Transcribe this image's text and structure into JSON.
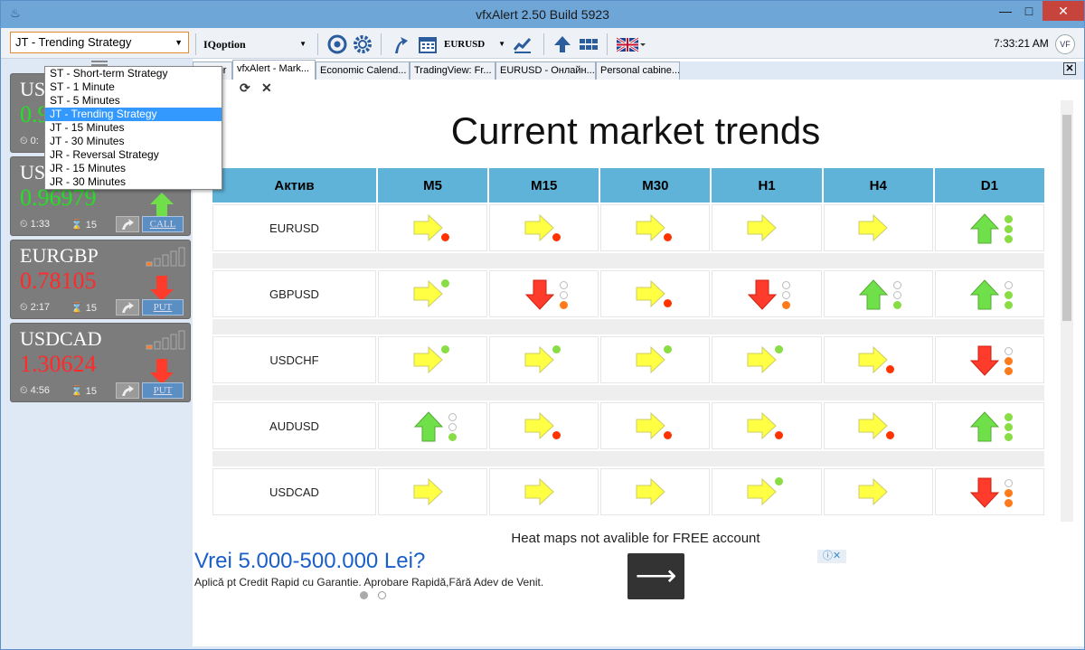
{
  "window": {
    "title": "vfxAlert 2.50 Build 5923",
    "minimize": "—",
    "maximize": "□",
    "close": "✕"
  },
  "toolbar": {
    "strategy_value": "JT - Trending Strategy",
    "broker_value": "IQoption",
    "pair_value": "EURUSD",
    "clock": "7:33:21 AM",
    "icons": [
      "chrome-icon",
      "settings-icon",
      "trend-arrow-icon",
      "calendar-icon",
      "chart-line-icon",
      "up-arrow-icon",
      "grid-icon",
      "uk-flag-icon"
    ]
  },
  "strategy_options": [
    "ST - Short-term Strategy",
    "ST - 1 Minute",
    "ST - 5 Minutes",
    "JT - Trending Strategy",
    "JT - 15 Minutes",
    "JT - 30 Minutes",
    "JR - Reversal Strategy",
    "JR - 15 Minutes",
    "JR - 30 Minutes"
  ],
  "selected_strategy_index": 3,
  "signals": [
    {
      "pair": "USD",
      "price": "0.9",
      "price_color": "#22e022",
      "time": "0:",
      "expiry": "15",
      "action": "",
      "direction": "none",
      "strength": 0
    },
    {
      "pair": "USD",
      "price": "0.96979",
      "price_color": "#22e022",
      "time": "1:33",
      "expiry": "15",
      "action": "CALL",
      "direction": "up",
      "strength": 0
    },
    {
      "pair": "EURGBP",
      "price": "0.78105",
      "price_color": "#ff2a2a",
      "time": "2:17",
      "expiry": "15",
      "action": "PUT",
      "direction": "down",
      "strength": 1
    },
    {
      "pair": "USDCAD",
      "price": "1.30624",
      "price_color": "#ff2a2a",
      "time": "4:56",
      "expiry": "15",
      "action": "PUT",
      "direction": "down",
      "strength": 1
    }
  ],
  "tabs": [
    {
      "label": "Broker"
    },
    {
      "label": "vfxAlert - Mark..."
    },
    {
      "label": "Economic Calend..."
    },
    {
      "label": "TradingView: Fr..."
    },
    {
      "label": "EURUSD - Онлайн..."
    },
    {
      "label": "Personal cabine..."
    }
  ],
  "active_tab": 1,
  "page": {
    "title": "Current market trends",
    "columns": [
      "Актив",
      "M5",
      "M15",
      "M30",
      "H1",
      "H4",
      "D1"
    ],
    "rows": [
      {
        "asset": "EURUSD",
        "cells": [
          {
            "arrow": "right",
            "dots": [
              "red"
            ]
          },
          {
            "arrow": "right",
            "dots": [
              "red"
            ]
          },
          {
            "arrow": "right",
            "dots": [
              "red"
            ]
          },
          {
            "arrow": "right",
            "dots": []
          },
          {
            "arrow": "right",
            "dots": []
          },
          {
            "arrow": "up",
            "dots": [
              "green",
              "green",
              "green"
            ]
          }
        ]
      },
      {
        "asset": "GBPUSD",
        "cells": [
          {
            "arrow": "right",
            "dots": [
              "green"
            ]
          },
          {
            "arrow": "down",
            "dots": [
              "empty",
              "empty",
              "orange"
            ]
          },
          {
            "arrow": "right",
            "dots": [
              "red"
            ]
          },
          {
            "arrow": "down",
            "dots": [
              "empty",
              "empty",
              "orange"
            ]
          },
          {
            "arrow": "up",
            "dots": [
              "empty",
              "empty",
              "green"
            ]
          },
          {
            "arrow": "up",
            "dots": [
              "empty",
              "green",
              "green"
            ]
          }
        ]
      },
      {
        "asset": "USDCHF",
        "cells": [
          {
            "arrow": "right",
            "dots": [
              "green"
            ]
          },
          {
            "arrow": "right",
            "dots": [
              "green"
            ]
          },
          {
            "arrow": "right",
            "dots": [
              "green"
            ]
          },
          {
            "arrow": "right",
            "dots": [
              "green"
            ]
          },
          {
            "arrow": "right",
            "dots": [
              "red"
            ]
          },
          {
            "arrow": "down",
            "dots": [
              "empty",
              "orange",
              "orange"
            ]
          }
        ]
      },
      {
        "asset": "AUDUSD",
        "cells": [
          {
            "arrow": "up",
            "dots": [
              "empty",
              "empty",
              "green"
            ]
          },
          {
            "arrow": "right",
            "dots": [
              "red"
            ]
          },
          {
            "arrow": "right",
            "dots": [
              "red"
            ]
          },
          {
            "arrow": "right",
            "dots": [
              "red"
            ]
          },
          {
            "arrow": "right",
            "dots": [
              "red"
            ]
          },
          {
            "arrow": "up",
            "dots": [
              "green",
              "green",
              "green"
            ]
          }
        ]
      },
      {
        "asset": "USDCAD",
        "cells": [
          {
            "arrow": "right",
            "dots": []
          },
          {
            "arrow": "right",
            "dots": []
          },
          {
            "arrow": "right",
            "dots": []
          },
          {
            "arrow": "right",
            "dots": [
              "green"
            ]
          },
          {
            "arrow": "right",
            "dots": []
          },
          {
            "arrow": "down",
            "dots": [
              "empty",
              "orange",
              "orange"
            ]
          }
        ]
      }
    ]
  },
  "heat_note": "Heat maps not avalible for FREE account",
  "ad": {
    "title": "Vrei 5.000-500.000 Lei?",
    "subtitle": "Aplică pt Credit Rapid cu Garantie. Aprobare Rapidă,Fără Adev de Venit.",
    "button_glyph": "⟶",
    "badge": "ⓘ✕"
  },
  "colors": {
    "accent": "#5fb2d8",
    "up": "#6fe04a",
    "down": "#ff3b2b",
    "side": "#ffff44",
    "red_dot": "#ff3300",
    "green_dot": "#88dd44",
    "orange_dot": "#ff7a1a"
  }
}
